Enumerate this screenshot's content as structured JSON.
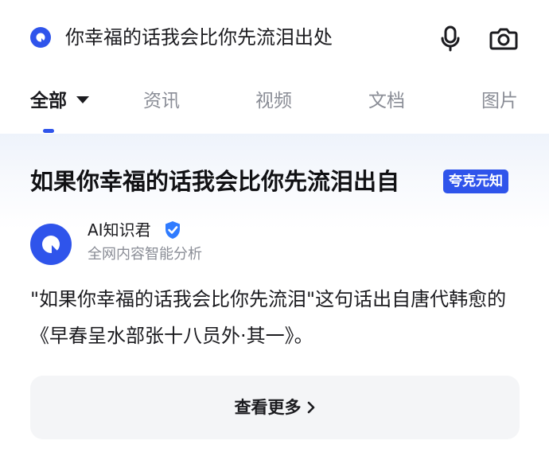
{
  "search": {
    "query": "你幸福的话我会比你先流泪出处",
    "icons": [
      "search-logo-icon",
      "microphone-icon",
      "camera-icon"
    ]
  },
  "tabs": [
    {
      "label": "全部",
      "active": true
    },
    {
      "label": "资讯",
      "active": false
    },
    {
      "label": "视频",
      "active": false
    },
    {
      "label": "文档",
      "active": false
    },
    {
      "label": "图片",
      "active": false
    }
  ],
  "result": {
    "title": "如果你幸福的话我会比你先流泪出自",
    "badge": "夸克元知",
    "author": {
      "name": "AI知识君",
      "verified": true,
      "description": "全网内容智能分析"
    },
    "answer": "\"如果你幸福的话我会比你先流泪\"这句话出自唐代韩愈的《早春呈水部张十八员外·其一》。",
    "more_label": "查看更多"
  },
  "colors": {
    "accent": "#2f54eb",
    "text_primary": "#1b1b1f",
    "text_secondary": "#8a8d96",
    "button_bg": "#f4f5f7"
  }
}
